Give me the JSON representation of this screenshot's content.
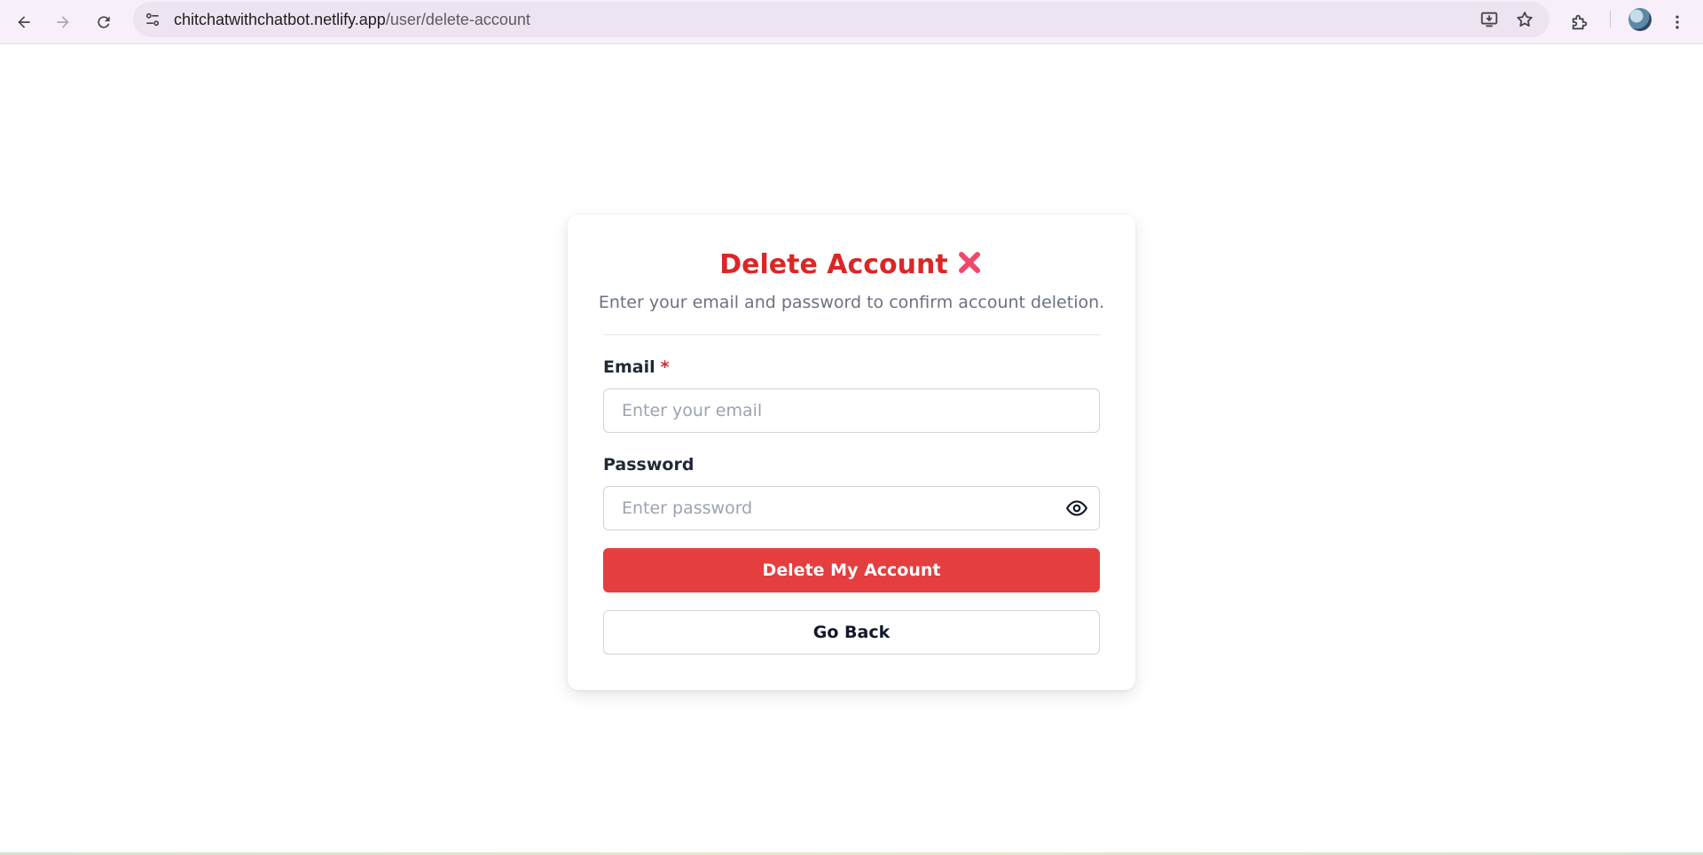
{
  "browser": {
    "url_host": "chitchatwithchatbot.netlify.app",
    "url_path": "/user/delete-account"
  },
  "icons": {
    "back": "arrow-left-icon",
    "forward": "arrow-right-icon",
    "reload": "reload-icon",
    "site_info": "tune-icon",
    "install": "install-app-icon",
    "bookmark": "star-icon",
    "extensions": "puzzle-icon",
    "profile": "avatar",
    "menu": "kebab-menu-icon",
    "title_x": "cross-mark-icon",
    "toggle_password": "eye-icon"
  },
  "colors": {
    "accent_red": "#dc2626",
    "button_red": "#e53e3e"
  },
  "card": {
    "title": "Delete Account",
    "subtitle": "Enter your email and password to confirm account deletion.",
    "email": {
      "label": "Email",
      "required_mark": "*",
      "value": "",
      "placeholder": "Enter your email"
    },
    "password": {
      "label": "Password",
      "value": "",
      "placeholder": "Enter password"
    },
    "delete_button": "Delete My Account",
    "back_button": "Go Back"
  }
}
